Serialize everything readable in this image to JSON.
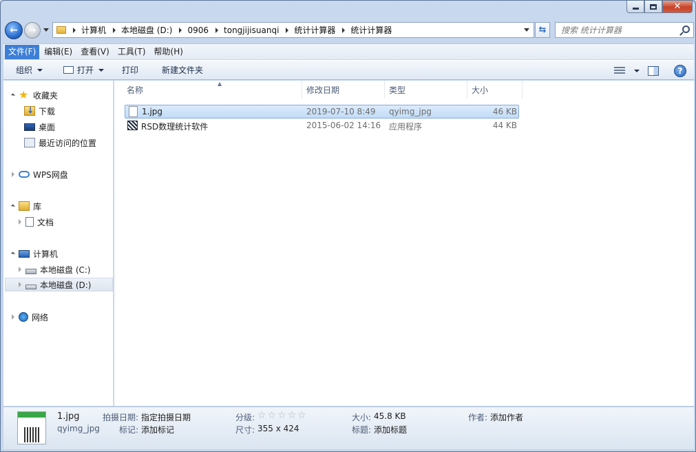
{
  "window": {
    "min_label": "",
    "max_label": "",
    "close_label": "✕"
  },
  "address": {
    "crumbs": [
      "计算机",
      "本地磁盘 (D:)",
      "0906",
      "tongjijisuanqi",
      "统计计算器",
      "统计计算器"
    ]
  },
  "search": {
    "placeholder": "搜索 统计计算器"
  },
  "menu": {
    "items": [
      "文件(F)",
      "编辑(E)",
      "查看(V)",
      "工具(T)",
      "帮助(H)"
    ]
  },
  "toolbar": {
    "organize": "组织",
    "open": "打开",
    "print": "打印",
    "new_folder": "新建文件夹"
  },
  "nav": {
    "favorites": "收藏夹",
    "downloads": "下载",
    "desktop": "桌面",
    "recent": "最近访问的位置",
    "wps": "WPS网盘",
    "library": "库",
    "documents": "文档",
    "computer": "计算机",
    "drive_c": "本地磁盘 (C:)",
    "drive_d": "本地磁盘 (D:)",
    "network": "网络"
  },
  "columns": {
    "name": "名称",
    "date": "修改日期",
    "type": "类型",
    "size": "大小"
  },
  "files": [
    {
      "name": "1.jpg",
      "date": "2019-07-10 8:49",
      "type": "qyimg_jpg",
      "size": "46 KB"
    },
    {
      "name": "RSD数理统计软件",
      "date": "2015-06-02 14:16",
      "type": "应用程序",
      "size": "44 KB"
    }
  ],
  "details": {
    "filename": "1.jpg",
    "filetype": "qyimg_jpg",
    "date_taken_label": "拍摄日期:",
    "date_taken_value": "指定拍摄日期",
    "tags_label": "标记:",
    "tags_value": "添加标记",
    "rating_label": "分级:",
    "rating_stars": "☆☆☆☆☆",
    "dimensions_label": "尺寸:",
    "dimensions_value": "355 x 424",
    "size_label": "大小:",
    "size_value": "45.8 KB",
    "title_label": "标题:",
    "title_value": "添加标题",
    "author_label": "作者:",
    "author_value": "添加作者"
  },
  "colors": {
    "selection": "#c2dcf7",
    "menu_active": "#3c7fd8",
    "chrome": "#bcd0ea"
  }
}
